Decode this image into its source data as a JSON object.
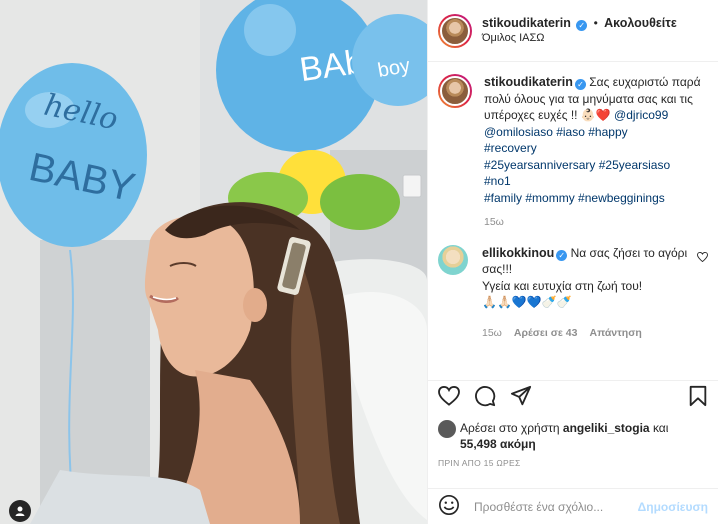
{
  "header": {
    "username": "stikoudikaterin",
    "separator": "•",
    "follow_label": "Ακολουθείτε",
    "location": "Όμιλος ΙΑΣΩ"
  },
  "caption": {
    "username": "stikoudikaterin",
    "text": "Σας ευχαριστώ παρά πολύ όλους για τα μηνύματα σας και τις υπέροχες ευχές !! 👶🏻❤️",
    "tags": [
      "@djrico99",
      "@omilosiaso",
      "#iaso",
      "#happy",
      "#recovery",
      "#25yearsanniversary",
      "#25yearsiaso",
      "#no1",
      "#family",
      "#mommy",
      "#newbegginings"
    ],
    "time": "15ω"
  },
  "comment": {
    "username": "ellikokkinou",
    "text": "Να σας ζήσει το αγόρι σας!!!",
    "text2": "Υγεία και ευτυχία στη ζωή του!",
    "emojis": "🙏🏻🙏🏻💙💙🍼🍼",
    "time": "15ω",
    "likes": "Αρέσει σε 43",
    "reply": "Απάντηση"
  },
  "likes": {
    "prefix": "Αρέσει στο χρήστη",
    "user": "angeliki_stogia",
    "conj": "και",
    "count": "55,498 ακόμη"
  },
  "date": "ΠΡΙΝ ΑΠΟ 15 ΩΡΕΣ",
  "add_comment": {
    "placeholder": "Προσθέστε ένα σχόλιο...",
    "post_label": "Δημοσίευση"
  },
  "photo": {
    "balloon_left_text_1": "hello",
    "balloon_left_text_2": "BABY",
    "balloon_right_text_1": "BAby",
    "balloon_right_text_2": "boy"
  },
  "colors": {
    "link": "#00376b",
    "verified": "#3897f0",
    "post_disabled": "#b3dbff",
    "balloon_blue": "#5fb3e6",
    "balloon_yellow": "#ffe03a",
    "balloon_green": "#8ac84a"
  }
}
